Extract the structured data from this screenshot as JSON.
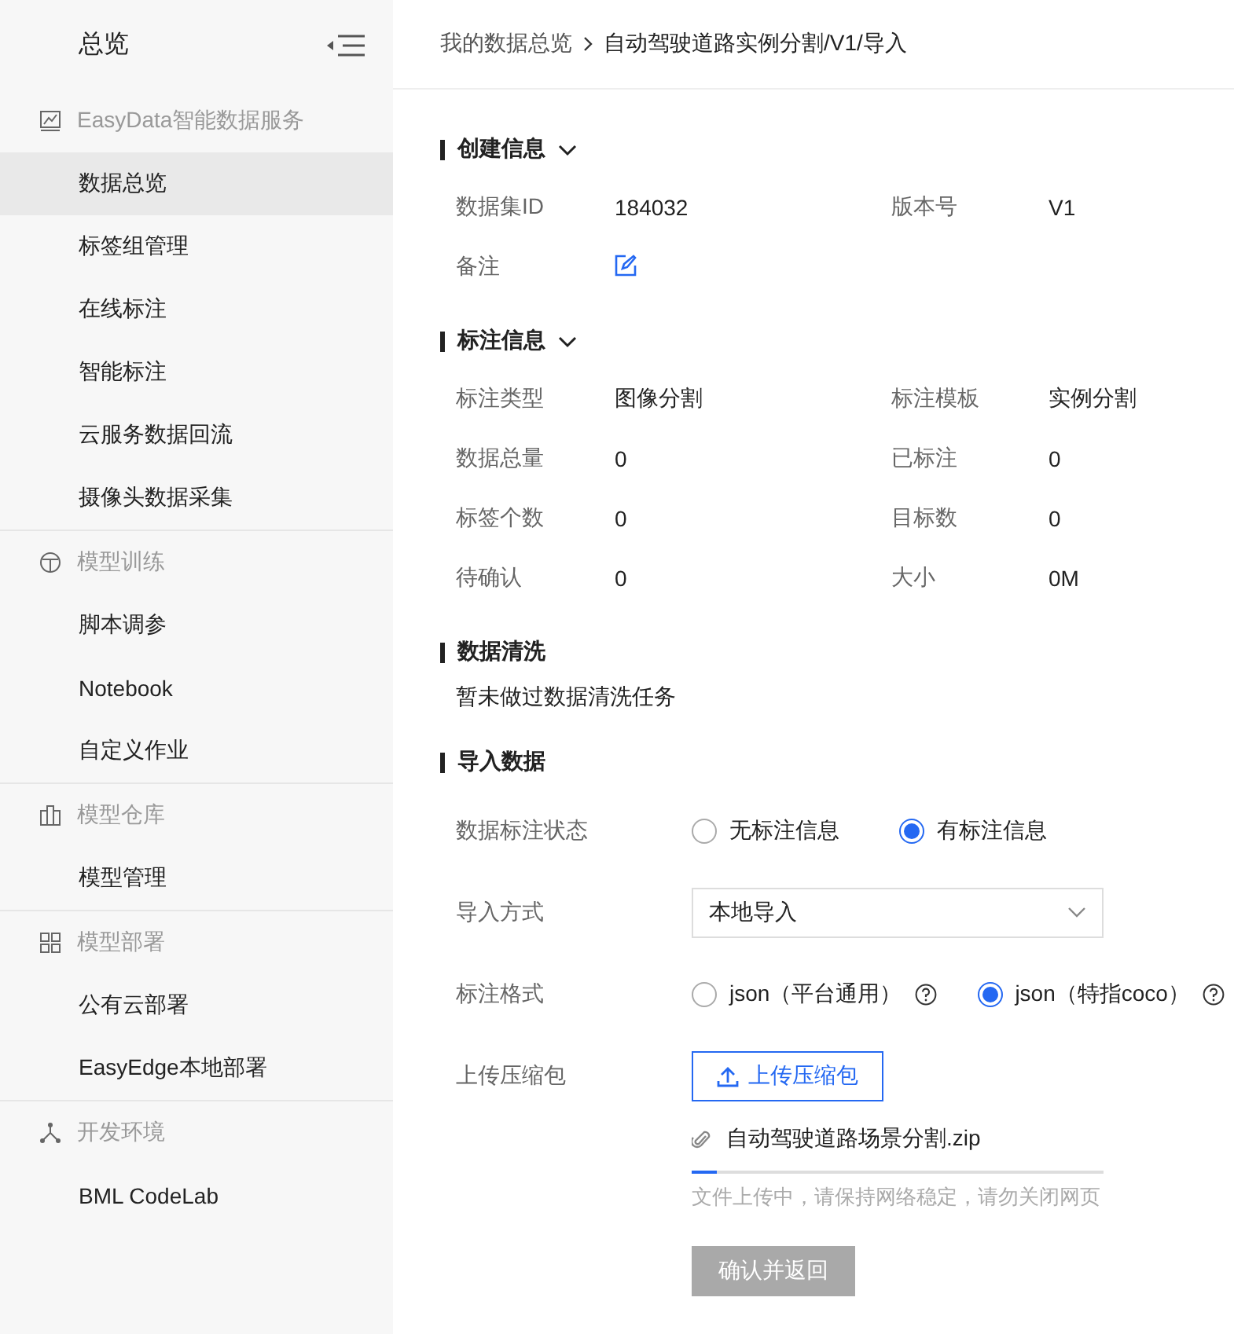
{
  "sidebar": {
    "title": "总览",
    "groups": [
      {
        "label": "EasyData智能数据服务",
        "items": [
          {
            "label": "数据总览",
            "selected": true
          },
          {
            "label": "标签组管理",
            "selected": false
          },
          {
            "label": "在线标注",
            "selected": false
          },
          {
            "label": "智能标注",
            "selected": false
          },
          {
            "label": "云服务数据回流",
            "selected": false
          },
          {
            "label": "摄像头数据采集",
            "selected": false
          }
        ]
      },
      {
        "label": "模型训练",
        "items": [
          {
            "label": "脚本调参",
            "selected": false
          },
          {
            "label": "Notebook",
            "selected": false
          },
          {
            "label": "自定义作业",
            "selected": false
          }
        ]
      },
      {
        "label": "模型仓库",
        "items": [
          {
            "label": "模型管理",
            "selected": false
          }
        ]
      },
      {
        "label": "模型部署",
        "items": [
          {
            "label": "公有云部署",
            "selected": false
          },
          {
            "label": "EasyEdge本地部署",
            "selected": false
          }
        ]
      },
      {
        "label": "开发环境",
        "items": [
          {
            "label": "BML CodeLab",
            "selected": false
          }
        ]
      }
    ]
  },
  "breadcrumb": [
    "我的数据总览",
    "自动驾驶道路实例分割/V1/导入"
  ],
  "creation_info": {
    "title": "创建信息",
    "expanded": true,
    "fields": [
      {
        "kind": "text",
        "label": "数据集ID",
        "value": "184032"
      },
      {
        "kind": "text",
        "label": "版本号",
        "value": "V1"
      },
      {
        "kind": "edit",
        "label": "备注"
      }
    ]
  },
  "annotation_info": {
    "title": "标注信息",
    "expanded": true,
    "fields": [
      {
        "kind": "text",
        "label": "标注类型",
        "value": "图像分割"
      },
      {
        "kind": "text",
        "label": "标注模板",
        "value": "实例分割"
      },
      {
        "kind": "text",
        "label": "数据总量",
        "value": "0"
      },
      {
        "kind": "text",
        "label": "已标注",
        "value": "0"
      },
      {
        "kind": "text",
        "label": "标签个数",
        "value": "0"
      },
      {
        "kind": "text",
        "label": "目标数",
        "value": "0"
      },
      {
        "kind": "text",
        "label": "待确认",
        "value": "0"
      },
      {
        "kind": "text",
        "label": "大小",
        "value": "0M"
      }
    ]
  },
  "data_cleaning": {
    "title": "数据清洗",
    "message": "暂未做过数据清洗任务"
  },
  "import_data": {
    "title": "导入数据",
    "annotation_status": {
      "label": "数据标注状态",
      "options": [
        {
          "label": "无标注信息",
          "selected": false
        },
        {
          "label": "有标注信息",
          "selected": true
        }
      ]
    },
    "import_method": {
      "label": "导入方式",
      "value": "本地导入"
    },
    "annotation_format": {
      "label": "标注格式",
      "options": [
        {
          "label": "json（平台通用）",
          "selected": false,
          "help": true
        },
        {
          "label": "json（特指coco）",
          "selected": true,
          "help": true
        }
      ]
    },
    "upload": {
      "label": "上传压缩包",
      "button": "上传压缩包",
      "file": "自动驾驶道路场景分割.zip",
      "level": 0.06,
      "hint": "文件上传中，请保持网络稳定，请勿关闭网页"
    },
    "confirm": {
      "label": "确认并返回",
      "disabled": true
    }
  }
}
